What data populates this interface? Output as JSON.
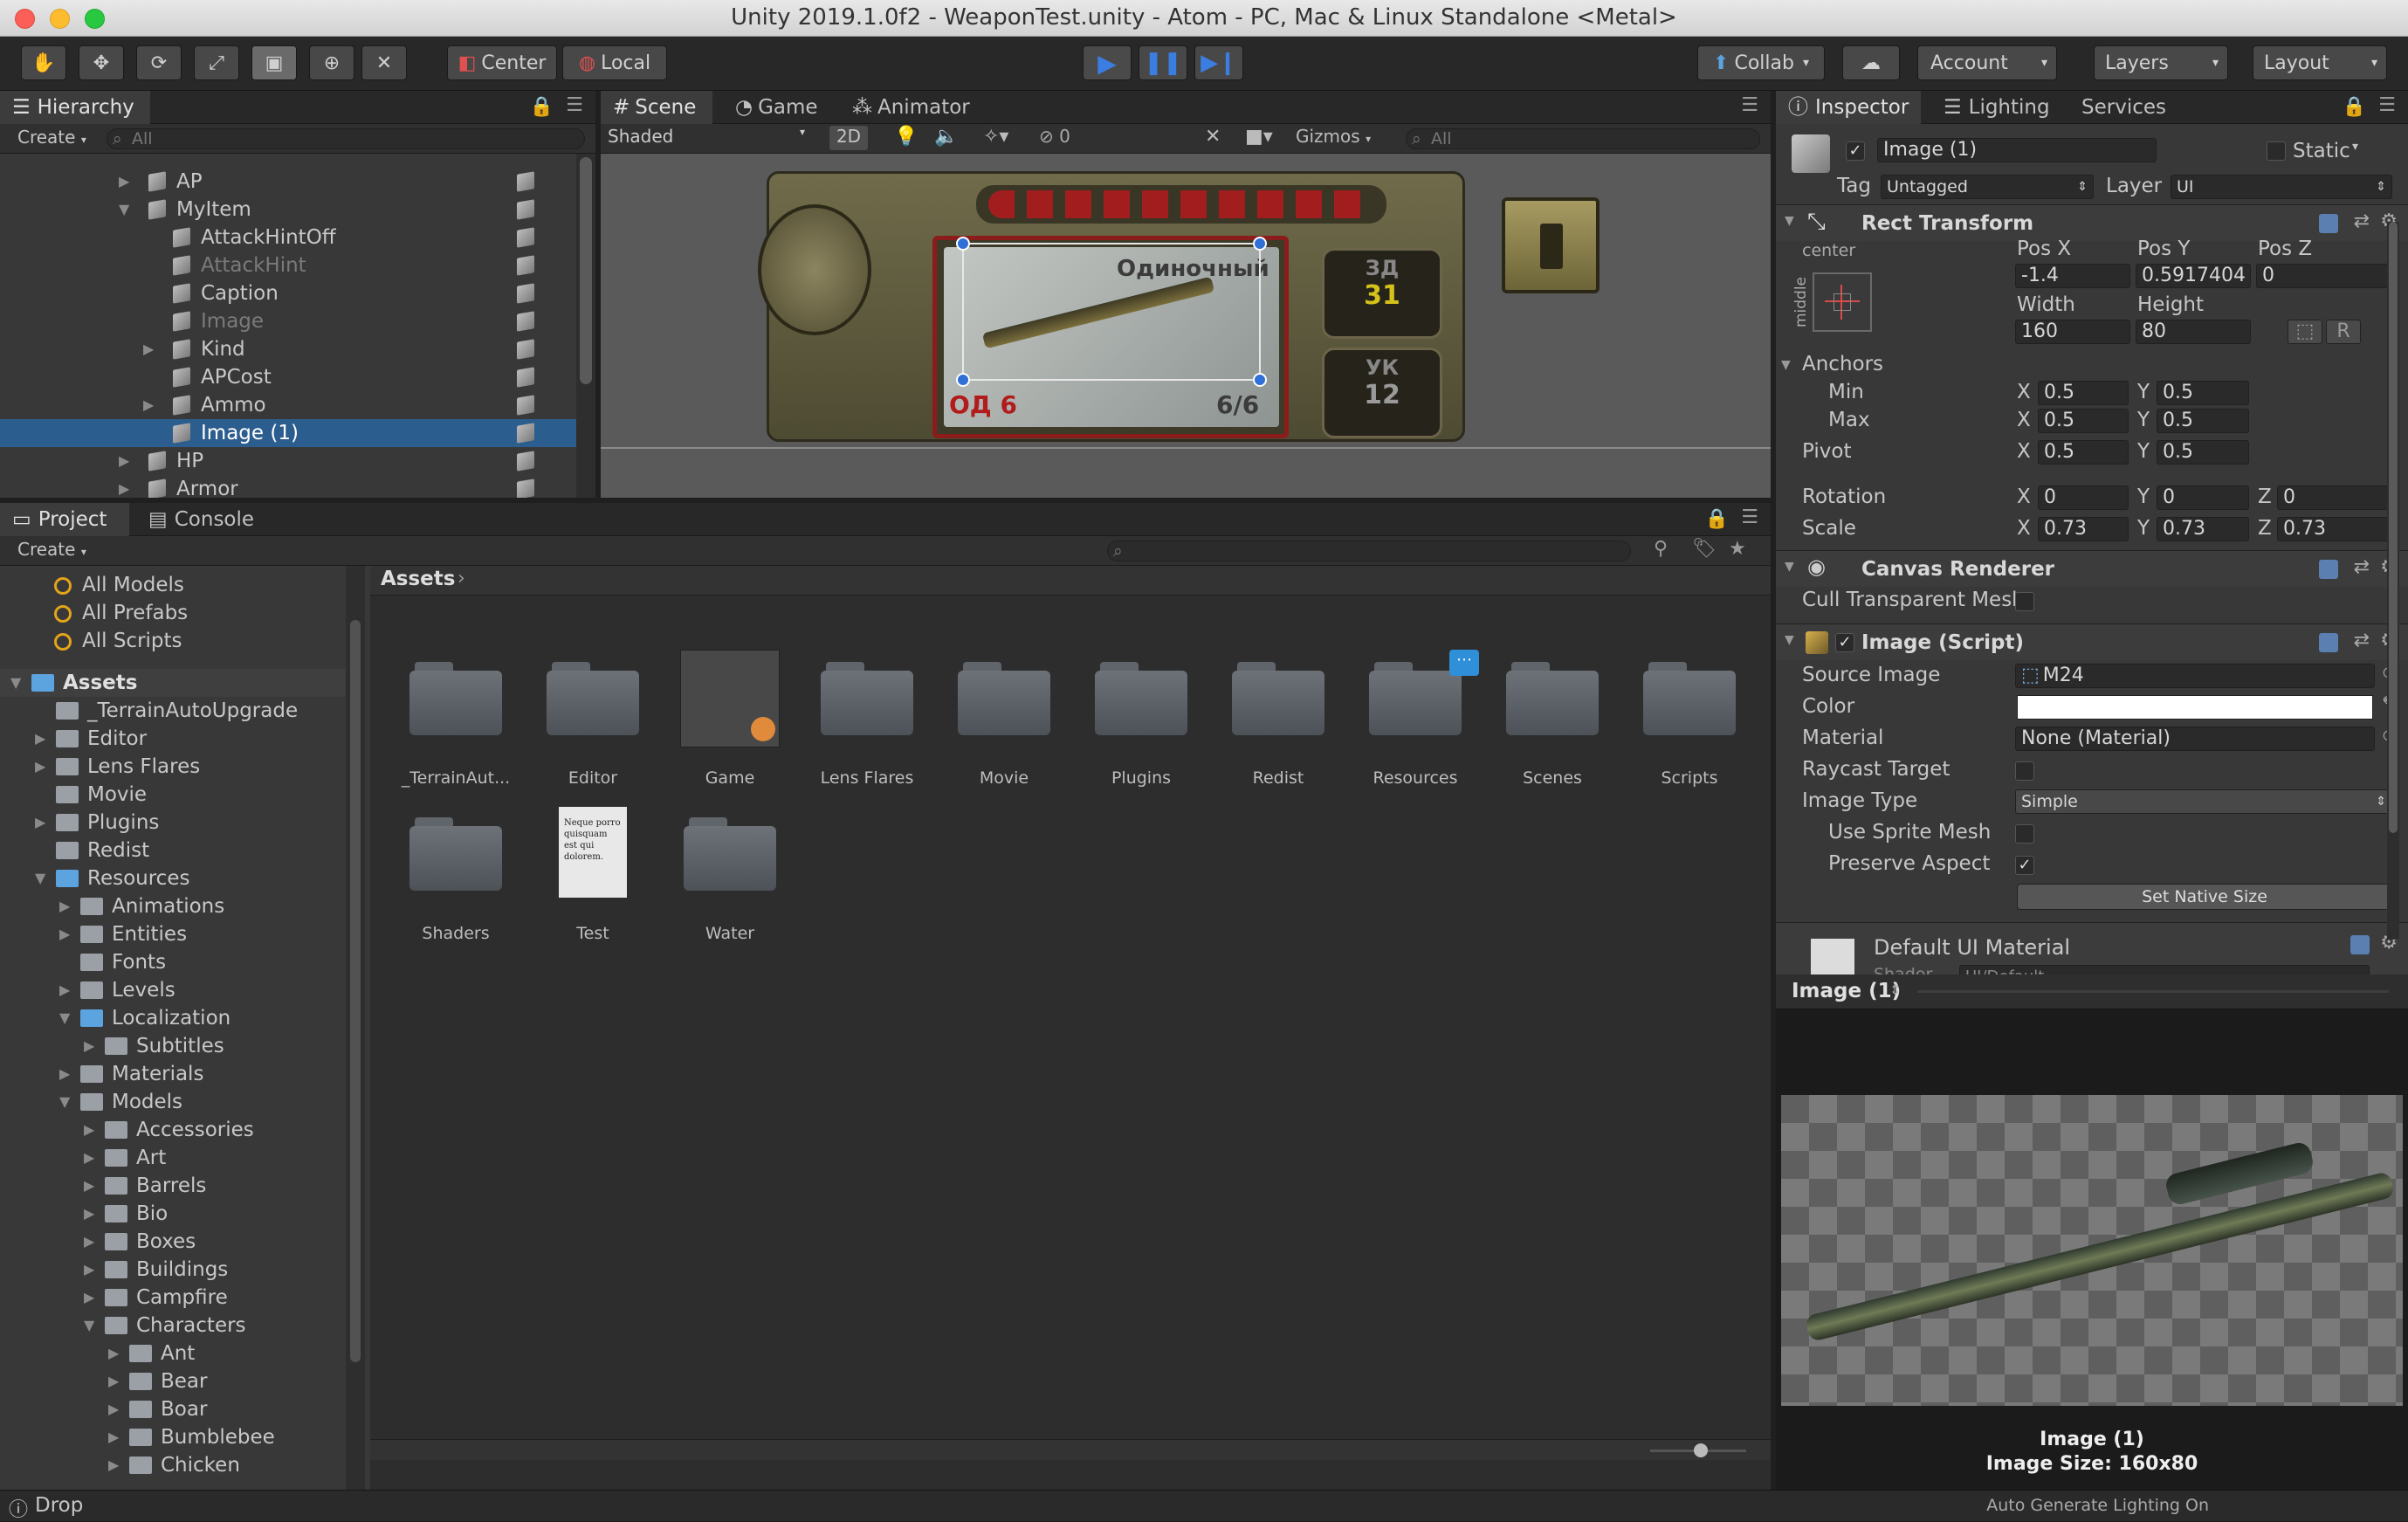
{
  "window_title": "Unity 2019.1.0f2 - WeaponTest.unity - Atom - PC, Mac & Linux Standalone <Metal>",
  "toolbar": {
    "pivot_center": "Center",
    "pivot_local": "Local",
    "collab": "Collab",
    "account": "Account",
    "layers": "Layers",
    "layout": "Layout"
  },
  "hierarchy": {
    "tab": "Hierarchy",
    "create": "Create",
    "search_placeholder": "All",
    "items": [
      {
        "label": "AP",
        "depth": 1,
        "expander": "collapsed",
        "dim": false,
        "selected": false
      },
      {
        "label": "MyItem",
        "depth": 1,
        "expander": "expanded",
        "dim": false,
        "selected": false
      },
      {
        "label": "AttackHintOff",
        "depth": 2,
        "expander": "none",
        "dim": false,
        "selected": false
      },
      {
        "label": "AttackHint",
        "depth": 2,
        "expander": "none",
        "dim": true,
        "selected": false
      },
      {
        "label": "Caption",
        "depth": 2,
        "expander": "none",
        "dim": false,
        "selected": false
      },
      {
        "label": "Image",
        "depth": 2,
        "expander": "none",
        "dim": true,
        "selected": false
      },
      {
        "label": "Kind",
        "depth": 2,
        "expander": "collapsed",
        "dim": false,
        "selected": false
      },
      {
        "label": "APCost",
        "depth": 2,
        "expander": "none",
        "dim": false,
        "selected": false
      },
      {
        "label": "Ammo",
        "depth": 2,
        "expander": "collapsed",
        "dim": false,
        "selected": false
      },
      {
        "label": "Image (1)",
        "depth": 2,
        "expander": "none",
        "dim": false,
        "selected": true
      },
      {
        "label": "HP",
        "depth": 1,
        "expander": "collapsed",
        "dim": false,
        "selected": false
      },
      {
        "label": "Armor",
        "depth": 1,
        "expander": "collapsed",
        "dim": false,
        "selected": false
      }
    ]
  },
  "scene": {
    "tabs": [
      "Scene",
      "Game",
      "Animator"
    ],
    "shading": "Shaded",
    "mode_2d": "2D",
    "hidden_count": "0",
    "gizmos": "Gizmos",
    "search_placeholder": "All",
    "card": {
      "mode_text": "Одиночный",
      "od_text": "ОД 6",
      "ammo_text": "6/6",
      "zd_label": "ЗД",
      "zd_value": "31",
      "uk_label": "УК",
      "uk_value": "12"
    }
  },
  "project": {
    "tabs": [
      "Project",
      "Console"
    ],
    "create": "Create",
    "favorites": [
      "All Models",
      "All Prefabs",
      "All Scripts"
    ],
    "tree": [
      {
        "label": "Assets",
        "depth": 0,
        "expander": "expanded",
        "blue": true,
        "bold": true
      },
      {
        "label": "_TerrainAutoUpgrade",
        "depth": 1,
        "expander": "none",
        "blue": false,
        "bold": false
      },
      {
        "label": "Editor",
        "depth": 1,
        "expander": "collapsed",
        "blue": false,
        "bold": false
      },
      {
        "label": "Lens Flares",
        "depth": 1,
        "expander": "collapsed",
        "blue": false,
        "bold": false
      },
      {
        "label": "Movie",
        "depth": 1,
        "expander": "none",
        "blue": false,
        "bold": false
      },
      {
        "label": "Plugins",
        "depth": 1,
        "expander": "collapsed",
        "blue": false,
        "bold": false
      },
      {
        "label": "Redist",
        "depth": 1,
        "expander": "none",
        "blue": false,
        "bold": false
      },
      {
        "label": "Resources",
        "depth": 1,
        "expander": "expanded",
        "blue": true,
        "bold": false
      },
      {
        "label": "Animations",
        "depth": 2,
        "expander": "collapsed",
        "blue": false,
        "bold": false
      },
      {
        "label": "Entities",
        "depth": 2,
        "expander": "collapsed",
        "blue": false,
        "bold": false
      },
      {
        "label": "Fonts",
        "depth": 2,
        "expander": "none",
        "blue": false,
        "bold": false
      },
      {
        "label": "Levels",
        "depth": 2,
        "expander": "collapsed",
        "blue": false,
        "bold": false
      },
      {
        "label": "Localization",
        "depth": 2,
        "expander": "expanded",
        "blue": true,
        "bold": false
      },
      {
        "label": "Subtitles",
        "depth": 3,
        "expander": "collapsed",
        "blue": false,
        "bold": false
      },
      {
        "label": "Materials",
        "depth": 2,
        "expander": "collapsed",
        "blue": false,
        "bold": false
      },
      {
        "label": "Models",
        "depth": 2,
        "expander": "expanded",
        "blue": false,
        "bold": false
      },
      {
        "label": "Accessories",
        "depth": 3,
        "expander": "collapsed",
        "blue": false,
        "bold": false
      },
      {
        "label": "Art",
        "depth": 3,
        "expander": "collapsed",
        "blue": false,
        "bold": false
      },
      {
        "label": "Barrels",
        "depth": 3,
        "expander": "collapsed",
        "blue": false,
        "bold": false
      },
      {
        "label": "Bio",
        "depth": 3,
        "expander": "collapsed",
        "blue": false,
        "bold": false
      },
      {
        "label": "Boxes",
        "depth": 3,
        "expander": "collapsed",
        "blue": false,
        "bold": false
      },
      {
        "label": "Buildings",
        "depth": 3,
        "expander": "collapsed",
        "blue": false,
        "bold": false
      },
      {
        "label": "Campfire",
        "depth": 3,
        "expander": "collapsed",
        "blue": false,
        "bold": false
      },
      {
        "label": "Characters",
        "depth": 3,
        "expander": "expanded",
        "blue": false,
        "bold": false
      },
      {
        "label": "Ant",
        "depth": 4,
        "expander": "collapsed",
        "blue": false,
        "bold": false
      },
      {
        "label": "Bear",
        "depth": 4,
        "expander": "collapsed",
        "blue": false,
        "bold": false
      },
      {
        "label": "Boar",
        "depth": 4,
        "expander": "collapsed",
        "blue": false,
        "bold": false
      },
      {
        "label": "Bumblebee",
        "depth": 4,
        "expander": "collapsed",
        "blue": false,
        "bold": false
      },
      {
        "label": "Chicken",
        "depth": 4,
        "expander": "collapsed",
        "blue": false,
        "bold": false
      }
    ],
    "breadcrumb": "Assets",
    "assets": [
      {
        "label": "_TerrainAut...",
        "kind": "folder"
      },
      {
        "label": "Editor",
        "kind": "folder"
      },
      {
        "label": "Game",
        "kind": "scene"
      },
      {
        "label": "Lens Flares",
        "kind": "folder"
      },
      {
        "label": "Movie",
        "kind": "folder"
      },
      {
        "label": "Plugins",
        "kind": "folder"
      },
      {
        "label": "Redist",
        "kind": "folder"
      },
      {
        "label": "Resources",
        "kind": "folder-badge"
      },
      {
        "label": "Scenes",
        "kind": "folder"
      },
      {
        "label": "Scripts",
        "kind": "folder"
      },
      {
        "label": "Shaders",
        "kind": "folder"
      },
      {
        "label": "Test",
        "kind": "document"
      },
      {
        "label": "Water",
        "kind": "folder"
      }
    ],
    "doc_preview_text": "Neque porro quisquam est qui dolorem."
  },
  "inspector": {
    "tabs": [
      "Inspector",
      "Lighting",
      "Services"
    ],
    "object_name": "Image (1)",
    "static_label": "Static",
    "tag_label": "Tag",
    "tag_value": "Untagged",
    "layer_label": "Layer",
    "layer_value": "UI",
    "rect_transform": {
      "title": "Rect Transform",
      "anchor_h": "center",
      "anchor_v": "middle",
      "pos_x_label": "Pos X",
      "pos_y_label": "Pos Y",
      "pos_z_label": "Pos Z",
      "pos_x": "-1.4",
      "pos_y": "0.5917404",
      "pos_z": "0",
      "width_label": "Width",
      "height_label": "Height",
      "width": "160",
      "height": "80",
      "r_button": "R",
      "anchors_label": "Anchors",
      "min_label": "Min",
      "max_label": "Max",
      "min_x": "0.5",
      "min_y": "0.5",
      "max_x": "0.5",
      "max_y": "0.5",
      "pivot_label": "Pivot",
      "pivot_x": "0.5",
      "pivot_y": "0.5",
      "rotation_label": "Rotation",
      "rot_x": "0",
      "rot_y": "0",
      "rot_z": "0",
      "scale_label": "Scale",
      "scale_x": "0.73",
      "scale_y": "0.73",
      "scale_z": "0.73",
      "x": "X",
      "y": "Y",
      "z": "Z"
    },
    "canvas_renderer": {
      "title": "Canvas Renderer",
      "cull_label": "Cull Transparent Mesh"
    },
    "image_script": {
      "title": "Image (Script)",
      "source_image_label": "Source Image",
      "source_image_value": "M24",
      "color_label": "Color",
      "color_value": "#ffffff",
      "material_label": "Material",
      "material_value": "None (Material)",
      "raycast_label": "Raycast Target",
      "image_type_label": "Image Type",
      "image_type_value": "Simple",
      "use_sprite_mesh_label": "Use Sprite Mesh",
      "preserve_aspect_label": "Preserve Aspect",
      "set_native_size": "Set Native Size"
    },
    "material": {
      "title": "Default UI Material",
      "shader_label": "Shader",
      "shader_value": "UI/Default"
    },
    "preview": {
      "header": "Image (1)",
      "name": "Image (1)",
      "size": "Image Size: 160x80"
    }
  },
  "status": {
    "left": "Drop",
    "right": "Auto Generate Lighting On"
  },
  "colors": {
    "selection": "#2c5d8f",
    "play_active": "#3b7de0",
    "panel_bg": "#383838"
  }
}
